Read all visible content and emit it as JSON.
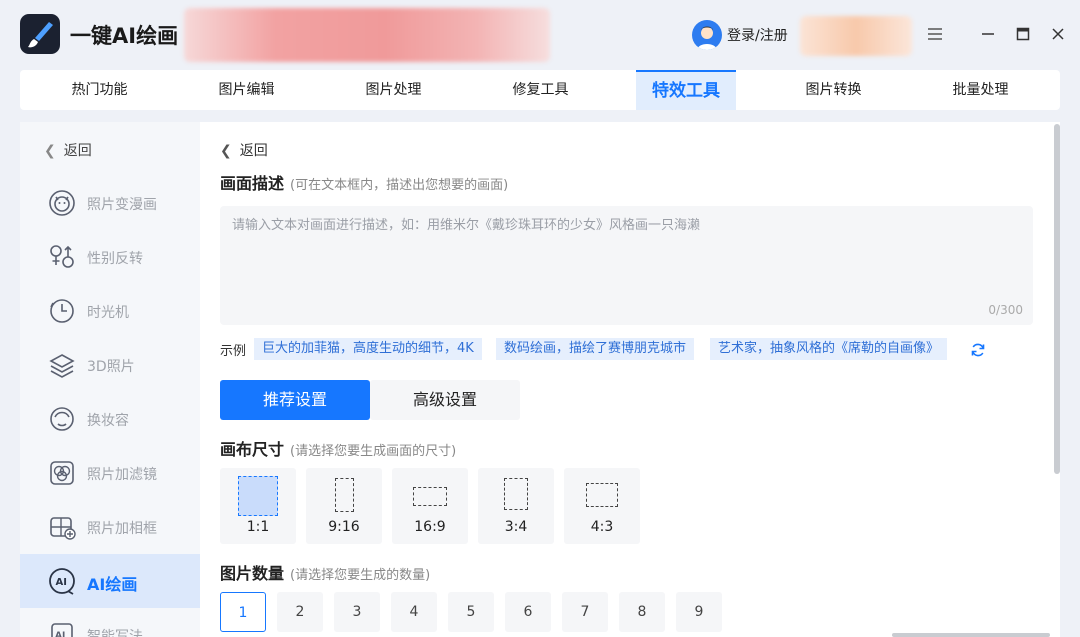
{
  "app": {
    "title": "一键AI绘画",
    "login_label": "登录/注册"
  },
  "nav": {
    "items": [
      {
        "label": "热门功能"
      },
      {
        "label": "图片编辑"
      },
      {
        "label": "图片处理"
      },
      {
        "label": "修复工具"
      },
      {
        "label": "特效工具",
        "active": true
      },
      {
        "label": "图片转换"
      },
      {
        "label": "批量处理"
      }
    ]
  },
  "sidebar": {
    "back_label": "返回",
    "items": [
      {
        "label": "照片变漫画",
        "icon": "cartoon-face-icon"
      },
      {
        "label": "性别反转",
        "icon": "gender-swap-icon"
      },
      {
        "label": "时光机",
        "icon": "clock-icon"
      },
      {
        "label": "3D照片",
        "icon": "layers-icon"
      },
      {
        "label": "换妆容",
        "icon": "makeup-face-icon"
      },
      {
        "label": "照片加滤镜",
        "icon": "filter-icon"
      },
      {
        "label": "照片加相框",
        "icon": "frame-icon"
      },
      {
        "label": "AI绘画",
        "icon": "ai-paint-icon",
        "active": true
      },
      {
        "label": "智能写法",
        "icon": "ai-write-icon"
      }
    ]
  },
  "main": {
    "back_label": "返回",
    "description": {
      "title": "画面描述",
      "hint": "(可在文本框内，描述出您想要的画面)",
      "placeholder": "请输入文本对画面进行描述，如：用维米尔《戴珍珠耳环的少女》风格画一只海濑",
      "value": "",
      "counter": "0/300"
    },
    "examples": {
      "label": "示例",
      "chips": [
        "巨大的加菲猫，高度生动的细节，4K",
        "数码绘画，描绘了赛博朋克城市",
        "艺术家，抽象风格的《席勒的自画像》"
      ]
    },
    "tabs": {
      "recommended": "推荐设置",
      "advanced": "高级设置"
    },
    "canvas": {
      "title": "画布尺寸",
      "hint": "(请选择您要生成画面的尺寸)",
      "ratios": [
        "1:1",
        "9:16",
        "16:9",
        "3:4",
        "4:3"
      ],
      "selected": "1:1"
    },
    "count": {
      "title": "图片数量",
      "hint": "(请选择您要生成的数量)",
      "options": [
        "1",
        "2",
        "3",
        "4",
        "5",
        "6",
        "7",
        "8",
        "9"
      ],
      "selected": "1"
    }
  },
  "colors": {
    "accent": "#1677ff",
    "chip_bg": "#e6effd"
  }
}
